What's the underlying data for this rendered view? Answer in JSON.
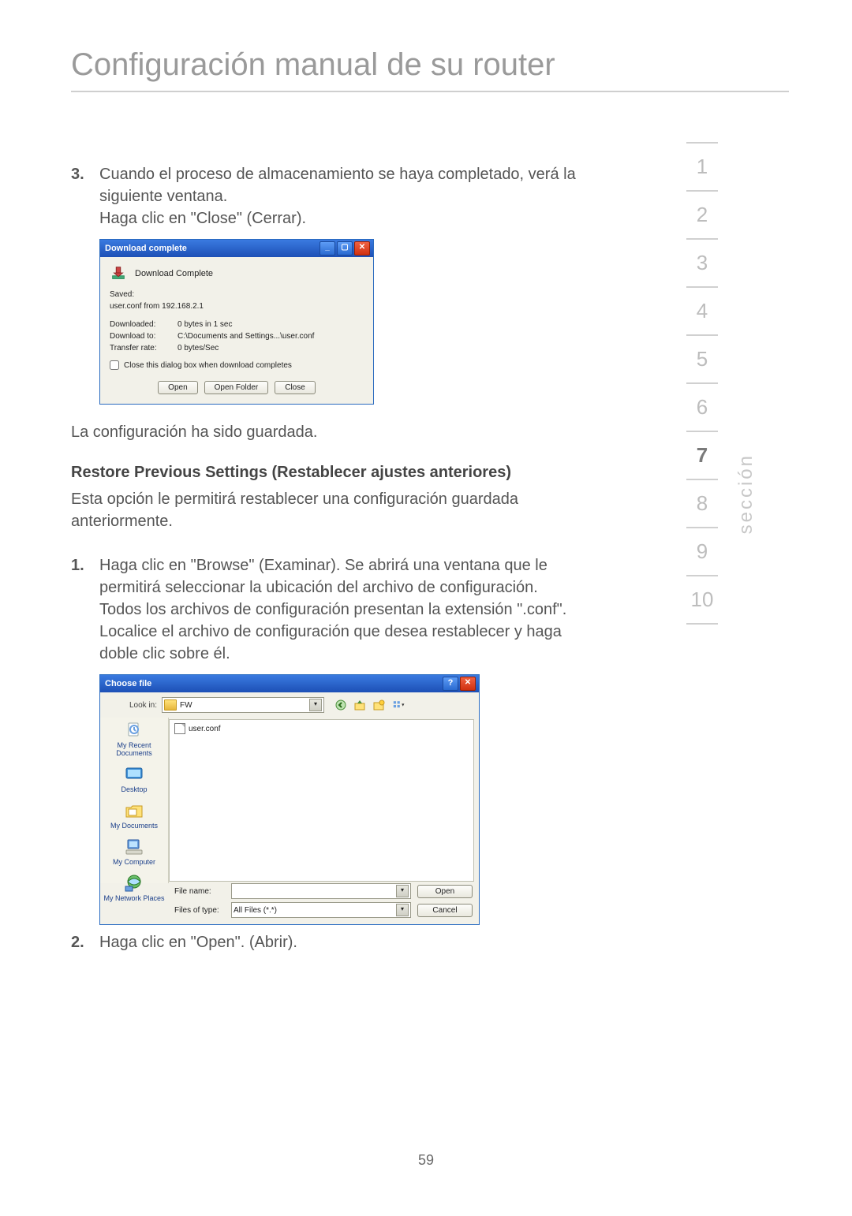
{
  "page": {
    "title": "Configuración manual de su router",
    "number": "59",
    "section_label": "sección"
  },
  "sidenav": {
    "items": [
      "1",
      "2",
      "3",
      "4",
      "5",
      "6",
      "7",
      "8",
      "9",
      "10"
    ],
    "active_index": 6
  },
  "step3": {
    "num": "3.",
    "line1": "Cuando el proceso de almacenamiento se haya completado, verá la siguiente ventana.",
    "line2": "Haga clic en \"Close\" (Cerrar)."
  },
  "download_dialog": {
    "title": "Download complete",
    "header_text": "Download Complete",
    "saved_label": "Saved:",
    "saved_value": "user.conf from 192.168.2.1",
    "rows": {
      "downloaded_k": "Downloaded:",
      "downloaded_v": "0 bytes in 1 sec",
      "downloadto_k": "Download to:",
      "downloadto_v": "C:\\Documents and Settings...\\user.conf",
      "transfer_k": "Transfer rate:",
      "transfer_v": "0 bytes/Sec"
    },
    "checkbox_label": "Close this dialog box when download completes",
    "buttons": {
      "open": "Open",
      "open_folder": "Open Folder",
      "close": "Close"
    }
  },
  "after_dialog_line": "La configuración ha sido guardada.",
  "restore": {
    "heading": "Restore Previous Settings (Restablecer ajustes anteriores)",
    "body": "Esta opción le permitirá restablecer una configuración guardada anteriormente."
  },
  "step1": {
    "num": "1.",
    "text": "Haga clic en \"Browse\" (Examinar). Se abrirá una ventana que le permitirá seleccionar la ubicación del archivo de configuración. Todos los archivos de configuración presentan la extensión \".conf\". Localice el archivo de configuración que desea restablecer y haga doble clic sobre él."
  },
  "choose_dialog": {
    "title": "Choose file",
    "look_in_label": "Look in:",
    "look_in_value": "FW",
    "file_item": "user.conf",
    "places": {
      "recent": "My Recent Documents",
      "desktop": "Desktop",
      "mydocs": "My Documents",
      "mycomputer": "My Computer",
      "network": "My Network Places"
    },
    "filename_label": "File name:",
    "filetype_label": "Files of type:",
    "filetype_value": "All Files (*.*)",
    "buttons": {
      "open": "Open",
      "cancel": "Cancel"
    }
  },
  "step2": {
    "num": "2.",
    "text": "Haga clic en \"Open\". (Abrir)."
  }
}
